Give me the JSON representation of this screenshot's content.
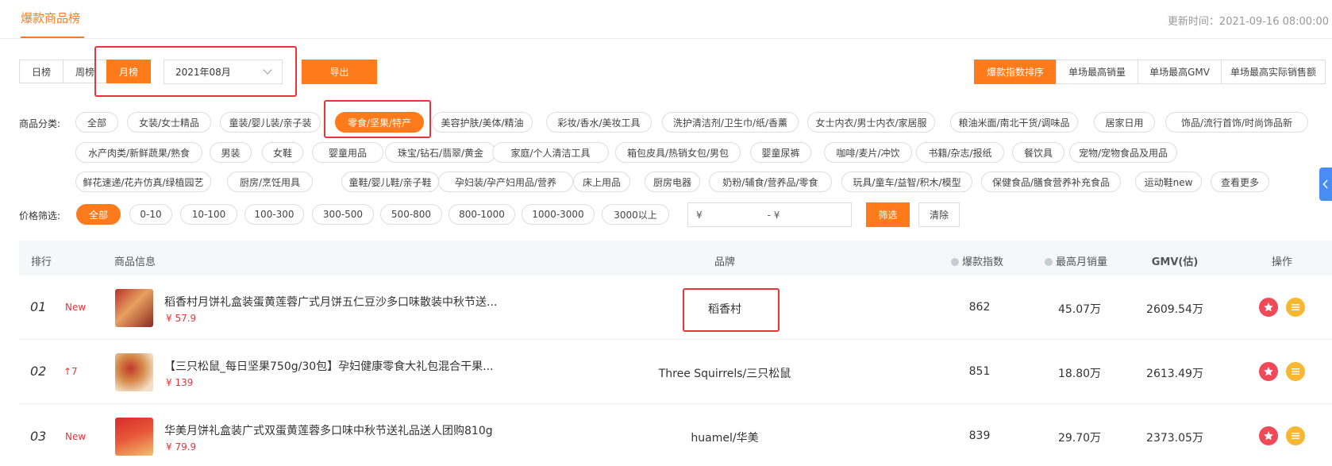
{
  "header": {
    "title": "爆款商品榜",
    "update_label": "更新时间：",
    "update_time": "2021-09-16 08:00:00"
  },
  "period_tabs": [
    "日榜",
    "周榜",
    "月榜"
  ],
  "month_select": {
    "value": "2021年08月"
  },
  "export_button": "导出",
  "sort_buttons": [
    "爆款指数排序",
    "单场最高销量",
    "单场最高GMV",
    "单场最高实际销售额"
  ],
  "category": {
    "label": "商品分类:",
    "rows": [
      [
        "全部",
        "女装/女士精品",
        "童装/婴儿装/亲子装",
        "零食/坚果/特产",
        "美容护肤/美体/精油",
        "彩妆/香水/美妆工具",
        "洗护清洁剂/卫生巾/纸/香薰",
        "女士内衣/男士内衣/家居服",
        "粮油米面/南北干货/调味品",
        "居家日用",
        "饰品/流行首饰/时尚饰品新"
      ],
      [
        "水产肉类/新鲜蔬果/熟食",
        "男装",
        "女鞋",
        "婴童用品",
        "珠宝/钻石/翡翠/黄金",
        "家庭/个人清洁工具",
        "箱包皮具/热销女包/男包",
        "婴童尿裤",
        "咖啡/麦片/冲饮",
        "书籍/杂志/报纸",
        "餐饮具",
        "宠物/宠物食品及用品"
      ],
      [
        "鲜花速递/花卉仿真/绿植园艺",
        "厨房/烹饪用具",
        "童鞋/婴儿鞋/亲子鞋",
        "孕妇装/孕产妇用品/营养",
        "床上用品",
        "厨房电器",
        "奶粉/辅食/营养品/零食",
        "玩具/童车/益智/积木/模型",
        "保健食品/膳食营养补充食品",
        "运动鞋new",
        "查看更多"
      ]
    ]
  },
  "price": {
    "label": "价格筛选:",
    "options": [
      "全部",
      "0-10",
      "10-100",
      "100-300",
      "300-500",
      "500-800",
      "800-1000",
      "1000-3000",
      "3000以上"
    ],
    "range_from": "¥",
    "range_to": "- ¥",
    "filter_button": "筛选",
    "clear_button": "清除"
  },
  "table": {
    "headers": {
      "rank": "排行",
      "product": "商品信息",
      "brand": "品牌",
      "index": "爆款指数",
      "max_monthly": "最高月销量",
      "gmv": "GMV(估)",
      "action": "操作"
    },
    "rows": [
      {
        "rank": "01",
        "trend": "New",
        "title": "稻香村月饼礼盒装蛋黄莲蓉广式月饼五仁豆沙多口味散装中秋节送...",
        "price": "¥ 57.9",
        "brand": "稻香村",
        "index": "862",
        "max_monthly": "45.07万",
        "gmv": "2609.54万"
      },
      {
        "rank": "02",
        "trend": "↑7",
        "title": "【三只松鼠_每日坚果750g/30包】孕妇健康零食大礼包混合干果...",
        "price": "¥ 139",
        "brand": "Three Squirrels/三只松鼠",
        "index": "851",
        "max_monthly": "18.80万",
        "gmv": "2613.49万"
      },
      {
        "rank": "03",
        "trend": "New",
        "title": "华美月饼礼盒装广式双蛋黄莲蓉多口味中秋节送礼品送人团购810g",
        "price": "¥ 79.9",
        "brand": "huamel/华美",
        "index": "839",
        "max_monthly": "29.70万",
        "gmv": "2373.05万"
      }
    ]
  },
  "colors": {
    "accent": "#ff7a1a",
    "highlight": "#e8333a",
    "fav": "#f04a5a",
    "detail": "#f7b733"
  },
  "icons": {
    "fav": "star-icon",
    "detail": "list-icon",
    "side": "chevron-left-icon"
  }
}
